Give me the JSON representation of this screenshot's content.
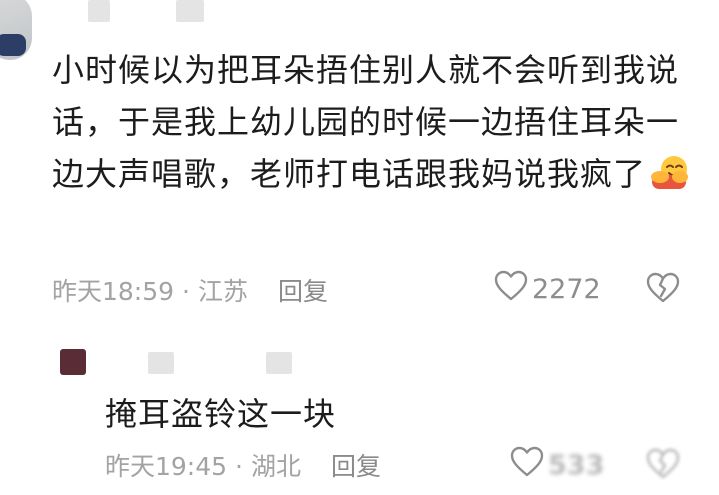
{
  "comment": {
    "text": "小时候以为把耳朵捂住别人就不会听到我说话，于是我上幼儿园的时候一边捂住耳朵一边大声唱歌，老师打电话跟我妈说我疯了",
    "emoji": "hugging-face-emoji",
    "time": "昨天18:59",
    "location": "江苏",
    "reply_label": "回复",
    "likes": "2272"
  },
  "reply": {
    "text": "掩耳盗铃这一块",
    "time": "昨天19:45",
    "location": "湖北",
    "reply_label": "回复",
    "likes": "533"
  },
  "separator": "·",
  "colors": {
    "meta": "#a3a3a3",
    "text": "#1c1c1c",
    "icon": "#8d8d8d"
  },
  "icons": [
    "heart-outline-icon",
    "broken-heart-icon"
  ]
}
